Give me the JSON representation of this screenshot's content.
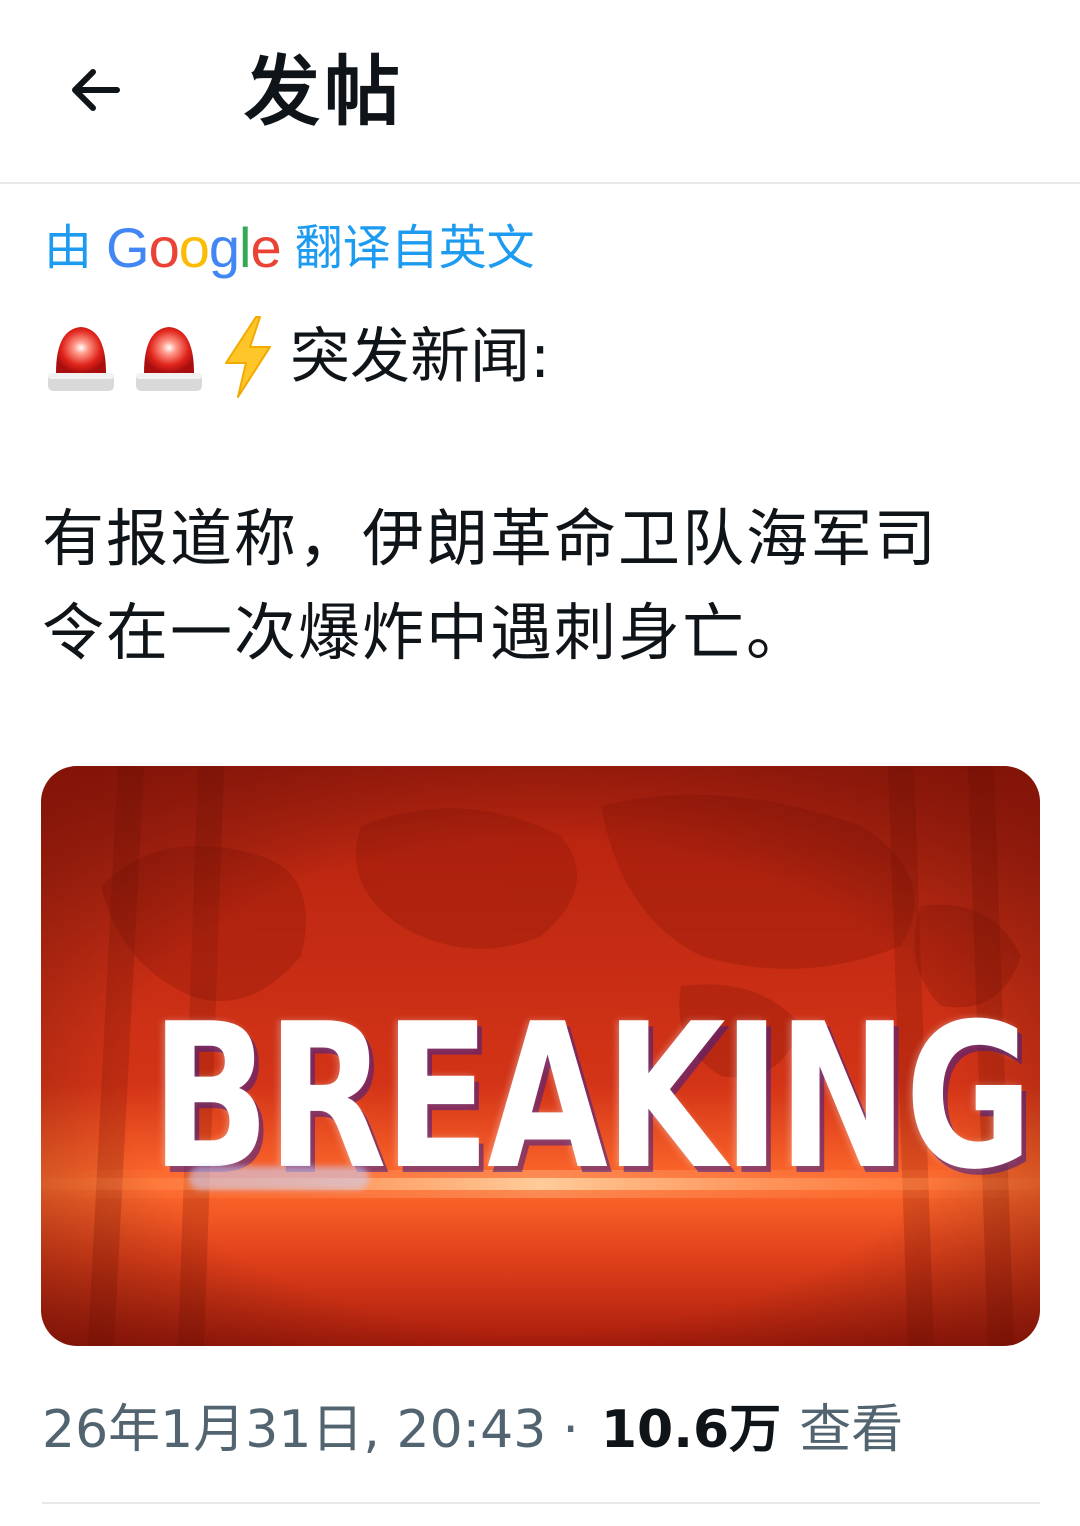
{
  "header": {
    "title": "发帖",
    "back_icon": "arrow-left-icon"
  },
  "translation_note": {
    "prefix": "由",
    "brand": "Google",
    "suffix": "翻译自英文",
    "color": "#1d9bf0"
  },
  "post": {
    "headline_emojis": [
      "police-siren-icon",
      "police-siren-icon",
      "lightning-bolt-icon"
    ],
    "headline": "突发新闻:",
    "body_line1": "有报道称，伊朗革命卫队海军司",
    "body_line2": "令在一次爆炸中遇刺身亡。",
    "image_caption": "BREAKING",
    "timestamp": "26年1月31日, 20:43",
    "separator": "·",
    "views_count": "10.6万",
    "views_label": "查看"
  },
  "colors": {
    "text_primary": "#0f1419",
    "text_secondary": "#536471",
    "divider": "#e6e9ec",
    "banner_red": "#c42a12",
    "banner_orange": "#ff5a1e"
  }
}
